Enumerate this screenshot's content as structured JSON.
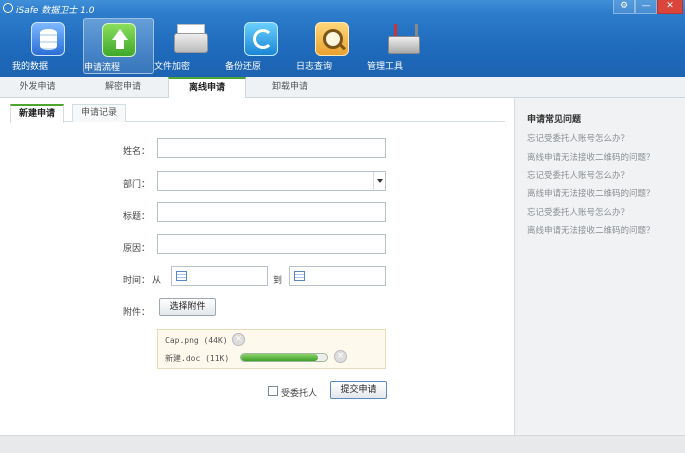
{
  "app": {
    "title": "iSafe 数据卫士 1.0"
  },
  "window_controls": {
    "settings": "⚙",
    "minimize": "—",
    "close": "✕"
  },
  "toolbar": [
    {
      "label": "我的数据",
      "icon": "database-icon"
    },
    {
      "label": "申请流程",
      "icon": "upload-icon"
    },
    {
      "label": "文件加密",
      "icon": "printer-icon"
    },
    {
      "label": "备份还原",
      "icon": "backup-icon"
    },
    {
      "label": "日志查询",
      "icon": "magnifier-icon"
    },
    {
      "label": "管理工具",
      "icon": "toolbox-icon"
    }
  ],
  "tabs": [
    "外发申请",
    "解密申请",
    "离线申请",
    "卸载申请"
  ],
  "subtabs": [
    "新建申请",
    "申请记录"
  ],
  "form": {
    "name_label": "姓名：",
    "dept_label": "部门：",
    "title_label": "标题：",
    "reason_label": "原因：",
    "time_label": "时间：",
    "from_label": "从",
    "to_label": "到",
    "attach_label": "附件：",
    "choose_attach": "选择附件",
    "attachments": [
      {
        "name": "Cap.png (44K)"
      },
      {
        "name": "新建.doc (11K)",
        "progress": 0.9
      }
    ],
    "delegate_label": "受委托人",
    "submit": "提交申请"
  },
  "faq": {
    "title": "申请常见问题",
    "items": [
      "忘记受委托人账号怎么办？",
      "离线申请无法接收二维码的问题？",
      "忘记受委托人账号怎么办？",
      "离线申请无法接收二维码的问题？",
      "忘记受委托人账号怎么办？",
      "离线申请无法接收二维码的问题？"
    ]
  },
  "colors": {
    "toolbar_blue": "#1f6bbd",
    "accent_green": "#4ca62f"
  }
}
